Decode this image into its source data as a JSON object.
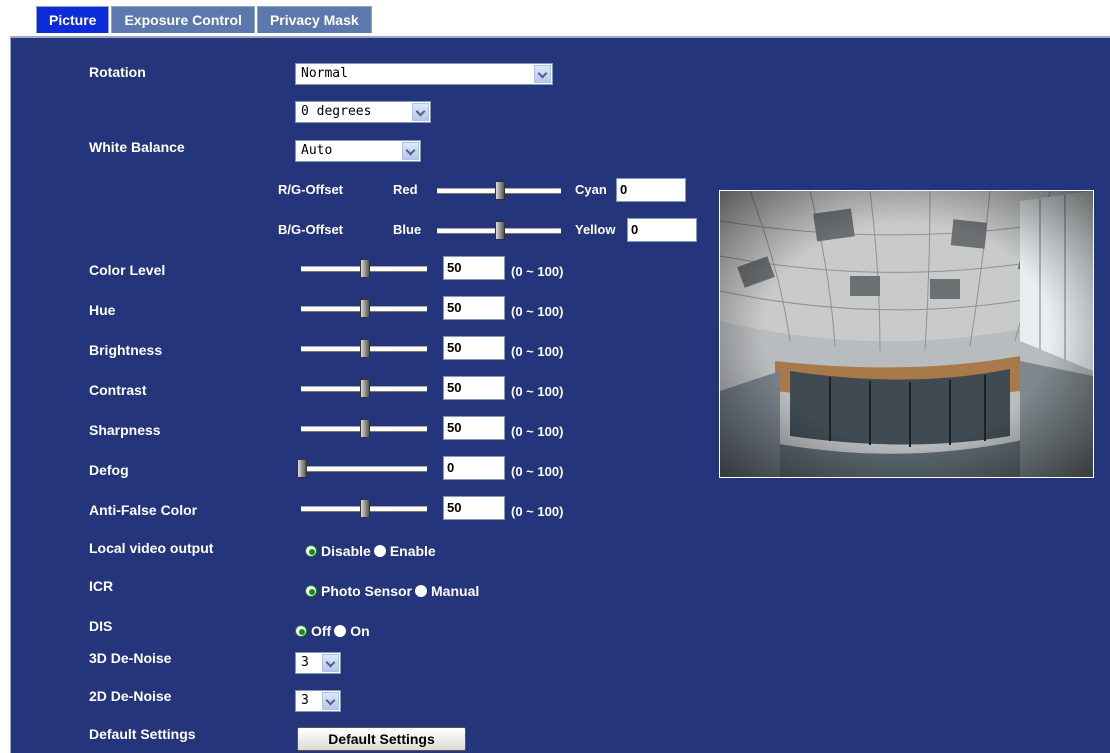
{
  "tabs": [
    "Picture",
    "Exposure Control",
    "Privacy Mask"
  ],
  "rotation": {
    "label": "Rotation",
    "mode": "Normal",
    "degrees": "0 degrees"
  },
  "white_balance": {
    "label": "White Balance",
    "value": "Auto",
    "rg": {
      "label": "R/G-Offset",
      "left": "Red",
      "right": "Cyan",
      "value": "0",
      "level": 0.5
    },
    "bg": {
      "label": "B/G-Offset",
      "left": "Blue",
      "right": "Yellow",
      "value": "0",
      "level": 0.5
    }
  },
  "range_text": "(0 ~ 100)",
  "adjustments": [
    {
      "label": "Color Level",
      "value": "50"
    },
    {
      "label": "Hue",
      "value": "50"
    },
    {
      "label": "Brightness",
      "value": "50"
    },
    {
      "label": "Contrast",
      "value": "50"
    },
    {
      "label": "Sharpness",
      "value": "50"
    },
    {
      "label": "Defog",
      "value": "0"
    },
    {
      "label": "Anti-False Color",
      "value": "50"
    }
  ],
  "local_video": {
    "label": "Local video output",
    "options": [
      "Disable",
      "Enable"
    ],
    "selected": "Disable"
  },
  "icr": {
    "label": "ICR",
    "options": [
      "Photo Sensor",
      "Manual"
    ],
    "selected": "Photo Sensor"
  },
  "dis": {
    "label": "DIS",
    "options": [
      "Off",
      "On"
    ],
    "selected": "Off"
  },
  "denoise_3d": {
    "label": "3D De-Noise",
    "value": "3"
  },
  "denoise_2d": {
    "label": "2D De-Noise",
    "value": "3"
  },
  "defaults": {
    "label": "Default Settings",
    "button": "Default Settings"
  },
  "colors": {
    "panel": "#24357c",
    "tab_active": "#0b2cd8",
    "tab": "#5b79ad"
  }
}
